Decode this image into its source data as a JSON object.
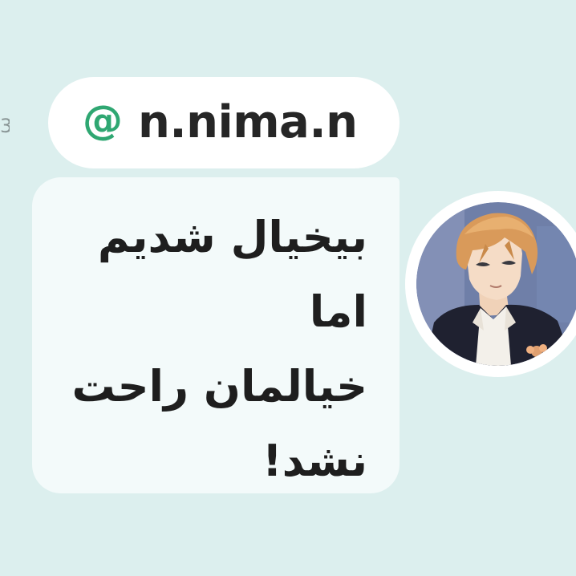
{
  "side_fragment": "3",
  "post": {
    "at_icon": "@",
    "username": "n.nima.n",
    "message_lines": [
      "بیخیال شدیم",
      "اما",
      "خیالمان راحت",
      "نشد!"
    ],
    "avatar": "anime-boy-avatar"
  },
  "colors": {
    "background": "#dcefee",
    "pill": "#ffffff",
    "bubble": "#f3fafa",
    "accent": "#2fa772",
    "text": "#262626"
  }
}
